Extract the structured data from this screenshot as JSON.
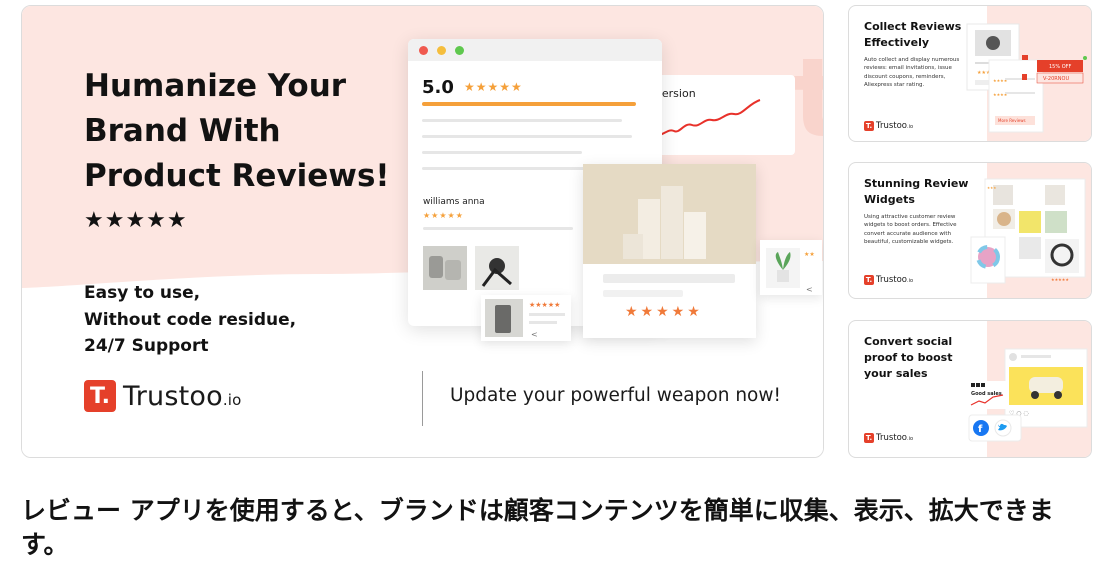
{
  "hero": {
    "title": "Humanize Your Brand With Product Reviews!",
    "stars": "★★★★★",
    "features": [
      "Easy to use,",
      "Without code residue,",
      "24/7 Support"
    ],
    "logo_mark": "T.",
    "logo_word": "Trustoo",
    "logo_suffix": ".io",
    "cta": "Update your powerful weapon now!",
    "mock": {
      "score": "5.0",
      "score_stars": "★★★★★",
      "reviewer": "williams anna",
      "reviewer_stars": "★★★★★",
      "conversion_label": "Conversion",
      "product_stars": "★★★★★",
      "small_stars": "★★★★★"
    }
  },
  "feature_cards": [
    {
      "title": "Collect Reviews Effectively",
      "description": "Auto collect and display numerous reviews: email invitations, issue discount coupons, reminders, Aliexpress star rating.",
      "badge_off": "15% OFF",
      "badge_code": "V-20RNOU",
      "btn_label": "More Reviews"
    },
    {
      "title": "Stunning Review Widgets",
      "description": "Using attractive customer review widgets to boost orders. Effective convert accurate audience with beautiful, customizable widgets."
    },
    {
      "title": "Convert social proof to boost your sales",
      "good_sales": "Good sales"
    }
  ],
  "logo_small": {
    "mark": "T.",
    "word": "Trustoo",
    "suffix": ".io"
  },
  "caption": "レビュー アプリを使用すると、ブランドは顧客コンテンツを簡単に収集、表示、拡大できます。",
  "colors": {
    "brand": "#e5402a",
    "pink": "#fde6e1",
    "star": "#f5a03a"
  }
}
